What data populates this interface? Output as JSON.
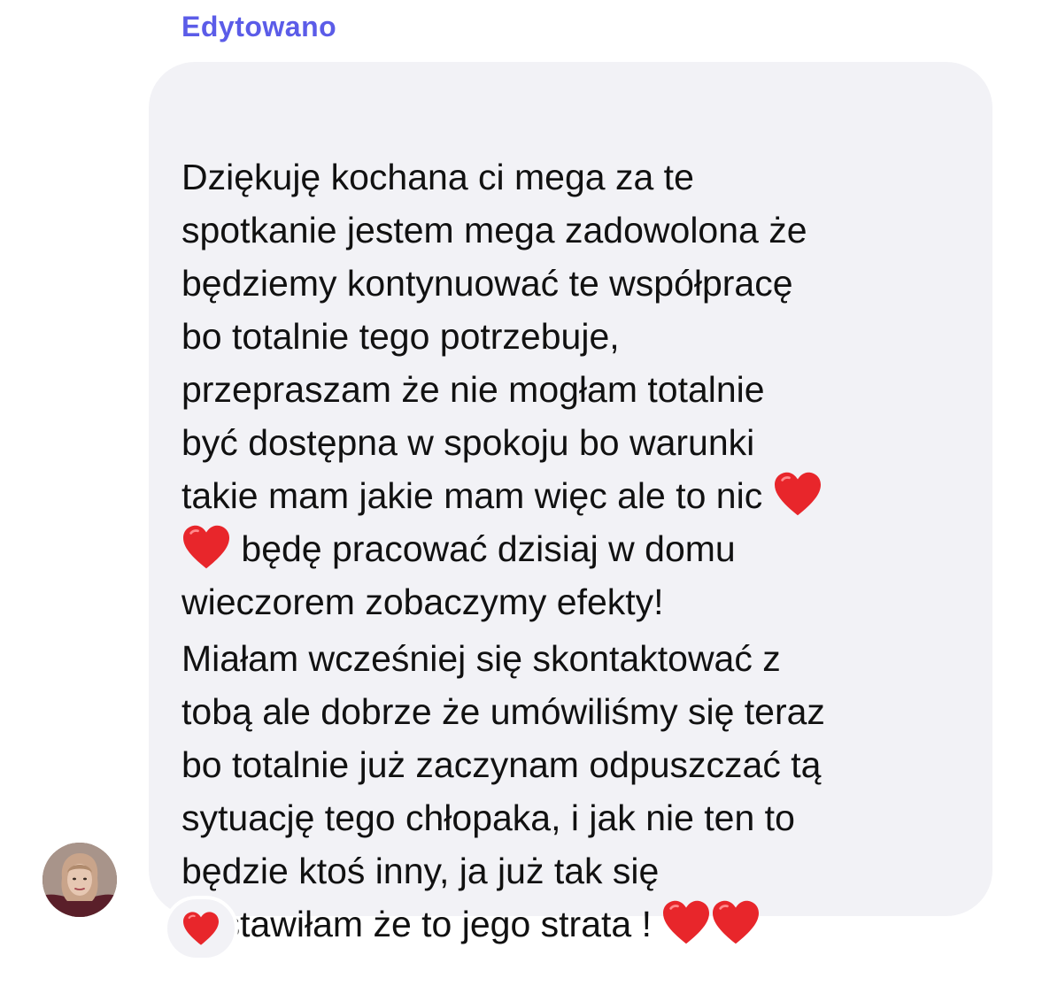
{
  "message": {
    "edited_label": "Edytowano",
    "paragraph1": {
      "line1": "Dziękuję kochana ci mega za te",
      "line2": "spotkanie jestem mega zadowolona że",
      "line3": "będziemy kontynuować te współpracę",
      "line4": "bo totalnie tego potrzebuje,",
      "line5": "przepraszam że nie mogłam totalnie",
      "line6": "być dostępna w spokoju bo warunki",
      "line7": "takie mam jakie mam więc ale to nic",
      "line8": " będę pracować dzisiaj w domu",
      "line9": "wieczorem zobaczymy efekty!"
    },
    "paragraph2": {
      "line1": "Miałam wcześniej się skontaktować z",
      "line2": "tobą ale dobrze że umówiliśmy się teraz",
      "line3": "bo totalnie już zaczynam odpuszczać tą",
      "line4": "sytuację tego chłopaka, i jak nie ten to",
      "line5": "będzie ktoś inny, ja już tak się",
      "line6": "nastawiłam że to jego strata !"
    },
    "reaction_icon": "red-heart-icon",
    "heart_color": "#e8262b"
  },
  "colors": {
    "edited_label": "#5b5ce8",
    "bubble_background": "#f2f2f6",
    "text": "#111111"
  }
}
